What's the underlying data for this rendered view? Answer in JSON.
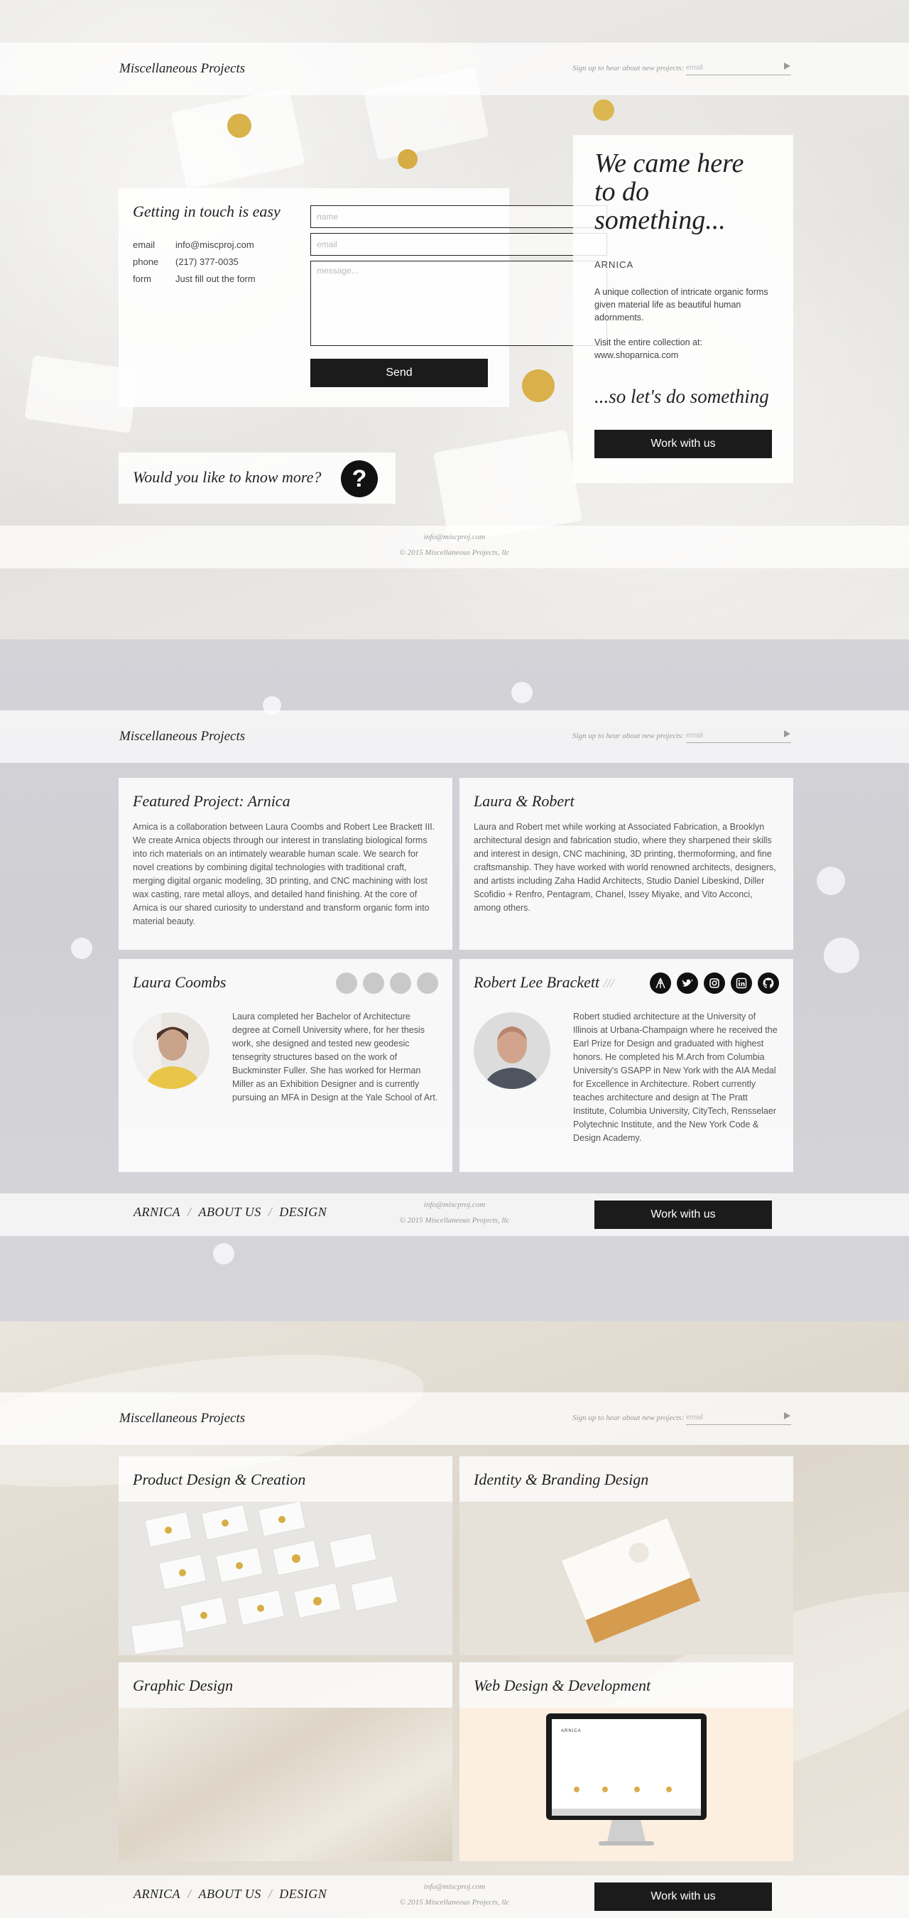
{
  "header": {
    "brand": "Miscellaneous Projects",
    "signup_text": "Sign up to hear about new projects:",
    "email_placeholder": "email"
  },
  "footer": {
    "email": "info@miscproj.com",
    "copyright": "© 2015 Miscellaneous Projects, llc",
    "nav": [
      "ARNICA",
      "ABOUT US",
      "DESIGN"
    ],
    "work_label": "Work with us"
  },
  "contact": {
    "title": "Getting in touch is easy",
    "rows": [
      {
        "label": "email",
        "value": "info@miscproj.com"
      },
      {
        "label": "phone",
        "value": "(217) 377-0035"
      },
      {
        "label": "form",
        "value": "Just fill out the form"
      }
    ],
    "name_placeholder": "name",
    "email_placeholder": "email",
    "message_placeholder": "message...",
    "send_label": "Send"
  },
  "know_more": {
    "title": "Would you like to know more?",
    "icon": "?"
  },
  "intro": {
    "headline": "We came here to do something...",
    "tag": "ARNICA",
    "p1": "A unique collection of intricate organic forms given material life as beautiful human adornments.",
    "p2": "Visit the entire collection at: www.shoparnica.com",
    "tagline": "...so let's do something",
    "work_label": "Work with us"
  },
  "about": {
    "featured": {
      "title": "Featured Project: Arnica",
      "text": "Arnica is a collaboration between Laura Coombs and Robert Lee Brackett III. We create Arnica objects through our interest in translating biological forms into rich materials on an intimately wearable human scale. We search for novel creations by combining digital technologies with traditional craft, merging digital organic modeling, 3D printing, and CNC machining with lost wax casting, rare metal alloys, and detailed hand finishing. At the core of Arnica is our shared curiosity to understand and transform organic form into material beauty."
    },
    "duo": {
      "title": "Laura & Robert",
      "text": "Laura and Robert met while working at Associated Fabrication, a Brooklyn architectural design and fabrication studio, where they sharpened their skills and interest in design, CNC machining, 3D printing, thermoforming, and fine craftsmanship. They have worked with world renowned architects, designers, and artists including Zaha Hadid Architects, Studio Daniel Libeskind, Diller Scofidio + Renfro, Pentagram, Chanel, Issey Miyake, and Vito Acconci, among others."
    },
    "laura": {
      "title": "Laura Coombs",
      "text": "Laura completed her Bachelor of Architecture degree at Cornell University where, for her thesis work, she designed and tested new geodesic tensegrity structures based on the work of Buckminster Fuller. She has worked for Herman Miller as an Exhibition Designer and is currently pursuing an MFA in Design at the Yale School of Art.",
      "socials": [
        "social-1-icon",
        "social-2-icon",
        "social-3-icon",
        "social-4-icon"
      ]
    },
    "robert": {
      "title": "Robert Lee Brackett",
      "title_suffix": "///",
      "text": "Robert studied architecture at the University of Illinois at Urbana-Champaign where he received the Earl Prize for Design and graduated with highest honors. He completed his M.Arch from Columbia University's GSAPP in New York with the AIA Medal for Excellence in Architecture. Robert currently teaches architecture and design at The Pratt Institute, Columbia University, CityTech, Rensselaer Polytechnic Institute, and the New York Code & Design Academy.",
      "socials": [
        "arnica-icon",
        "twitter-icon",
        "instagram-icon",
        "linkedin-icon",
        "github-icon"
      ]
    }
  },
  "services": [
    {
      "title": "Product Design & Creation"
    },
    {
      "title": "Identity & Branding Design"
    },
    {
      "title": "Graphic Design"
    },
    {
      "title": "Web Design & Development"
    }
  ],
  "mockup": {
    "brand": "ARNICA"
  },
  "colors": {
    "button": "#1b1b1b",
    "panel": "#ffffff",
    "text": "#222222"
  }
}
